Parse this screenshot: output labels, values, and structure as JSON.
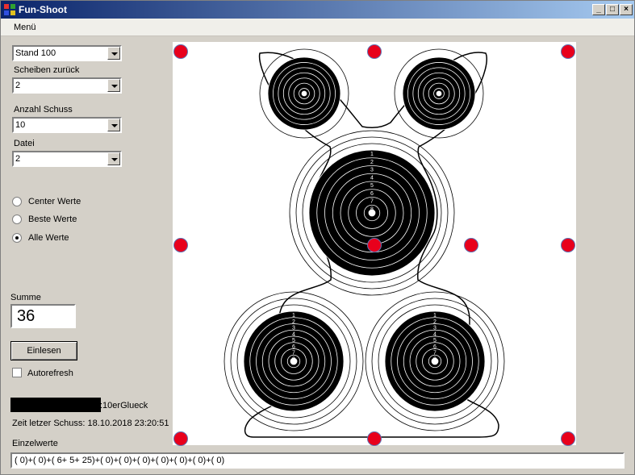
{
  "window": {
    "title": "Fun-Shoot",
    "min": "_",
    "max": "□",
    "close": "×"
  },
  "menu": {
    "label": "Menü"
  },
  "stand": {
    "value": "Stand 100"
  },
  "scheiben": {
    "label": "Scheiben zurück",
    "value": "2"
  },
  "anzahl": {
    "label": "Anzahl Schuss",
    "value": "10"
  },
  "datei": {
    "label": "Datei",
    "value": "2"
  },
  "radios": {
    "center": "Center Werte",
    "beste": "Beste Werte",
    "alle": "Alle Werte",
    "selected": "alle"
  },
  "summe": {
    "label": "Summe",
    "value": "36"
  },
  "einlesen": {
    "label": "Einlesen"
  },
  "autorefresh": {
    "label": "Autorefresh",
    "checked": false
  },
  "status": {
    "glueck": ":10erGlueck",
    "letzter": "Zeit letzer Schuss: 18.10.2018 23:20:51"
  },
  "einzelwerte": {
    "label": "Einzelwerte",
    "value": "( 0)+( 0)+( 6+ 5+ 25)+( 0)+( 0)+( 0)+( 0)+( 0)+( 0)+( 0)"
  },
  "target": {
    "ring_labels": [
      "1",
      "2",
      "3",
      "4",
      "5",
      "6",
      "7",
      "8"
    ]
  },
  "colors": {
    "hit": "#e8001c",
    "title_start": "#0a246a",
    "title_end": "#a6caf0"
  }
}
